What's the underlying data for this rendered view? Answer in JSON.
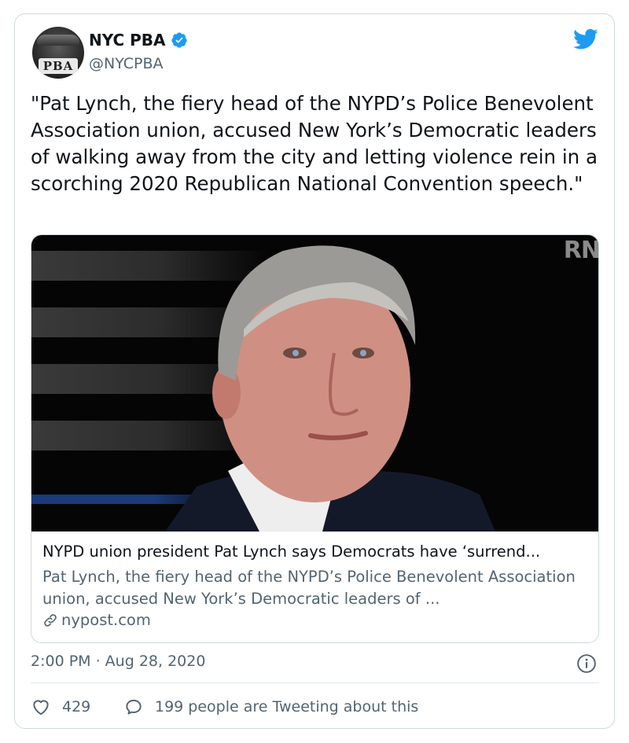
{
  "tweet": {
    "display_name": "NYC PBA",
    "handle": "@NYCPBA",
    "avatar_text": "PBA",
    "text": "\"Pat Lynch, the fiery head of the NYPD’s Police Benevolent Association union, accused New York’s Democratic leaders of walking away from the city and letting violence rein in a scorching 2020 Republican National Convention speech.\"",
    "timestamp": "2:00 PM · Aug 28, 2020"
  },
  "link_card": {
    "watermark": "RN",
    "title": "NYPD union president Pat Lynch says Democrats have ‘surrend...",
    "description": "Pat Lynch, the fiery head of the NYPD’s Police Benevolent Association union, accused New York’s Democratic leaders of ...",
    "domain": "nypost.com"
  },
  "actions": {
    "like_count": "429",
    "conversation_text": "199 people are Tweeting about this"
  },
  "colors": {
    "twitter_blue": "#1d9bf0",
    "secondary_text": "#536471",
    "primary_text": "#0f1419",
    "border": "#cfd9de"
  },
  "icons": {
    "verified": "verified-badge-icon",
    "brand": "twitter-bird-icon",
    "link": "link-icon",
    "info": "info-icon",
    "like": "heart-icon",
    "reply": "speech-bubble-icon"
  }
}
